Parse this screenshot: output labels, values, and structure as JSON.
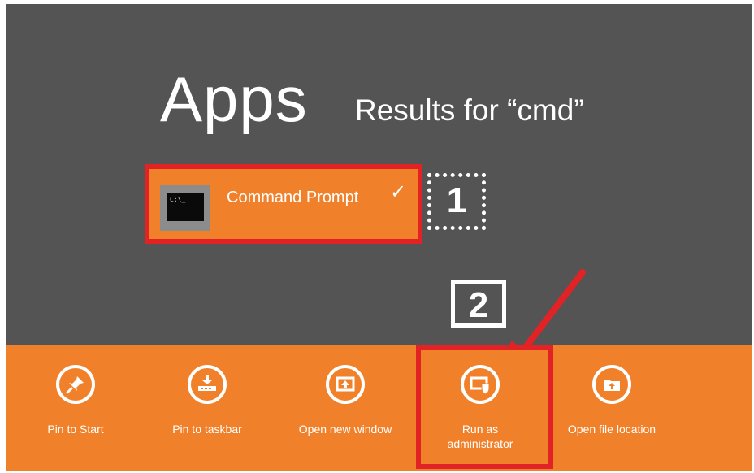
{
  "search": {
    "title": "Apps",
    "subtitle": "Results for “cmd”"
  },
  "result": {
    "label": "Command Prompt",
    "icon_text": "C:\\_",
    "icon": "terminal-icon"
  },
  "steps": {
    "step1": "1",
    "step2": "2"
  },
  "app_bar": {
    "commands": [
      {
        "label": "Pin to Start",
        "icon": "pin-icon"
      },
      {
        "label": "Pin to taskbar",
        "icon": "pin-taskbar-icon"
      },
      {
        "label": "Open new window",
        "icon": "new-window-icon"
      },
      {
        "label": "Run as administrator",
        "icon": "run-as-admin-icon"
      },
      {
        "label": "Open file location",
        "icon": "folder-icon"
      }
    ]
  },
  "colors": {
    "background": "#545454",
    "accent": "#f1802a",
    "highlight": "#e32226"
  }
}
